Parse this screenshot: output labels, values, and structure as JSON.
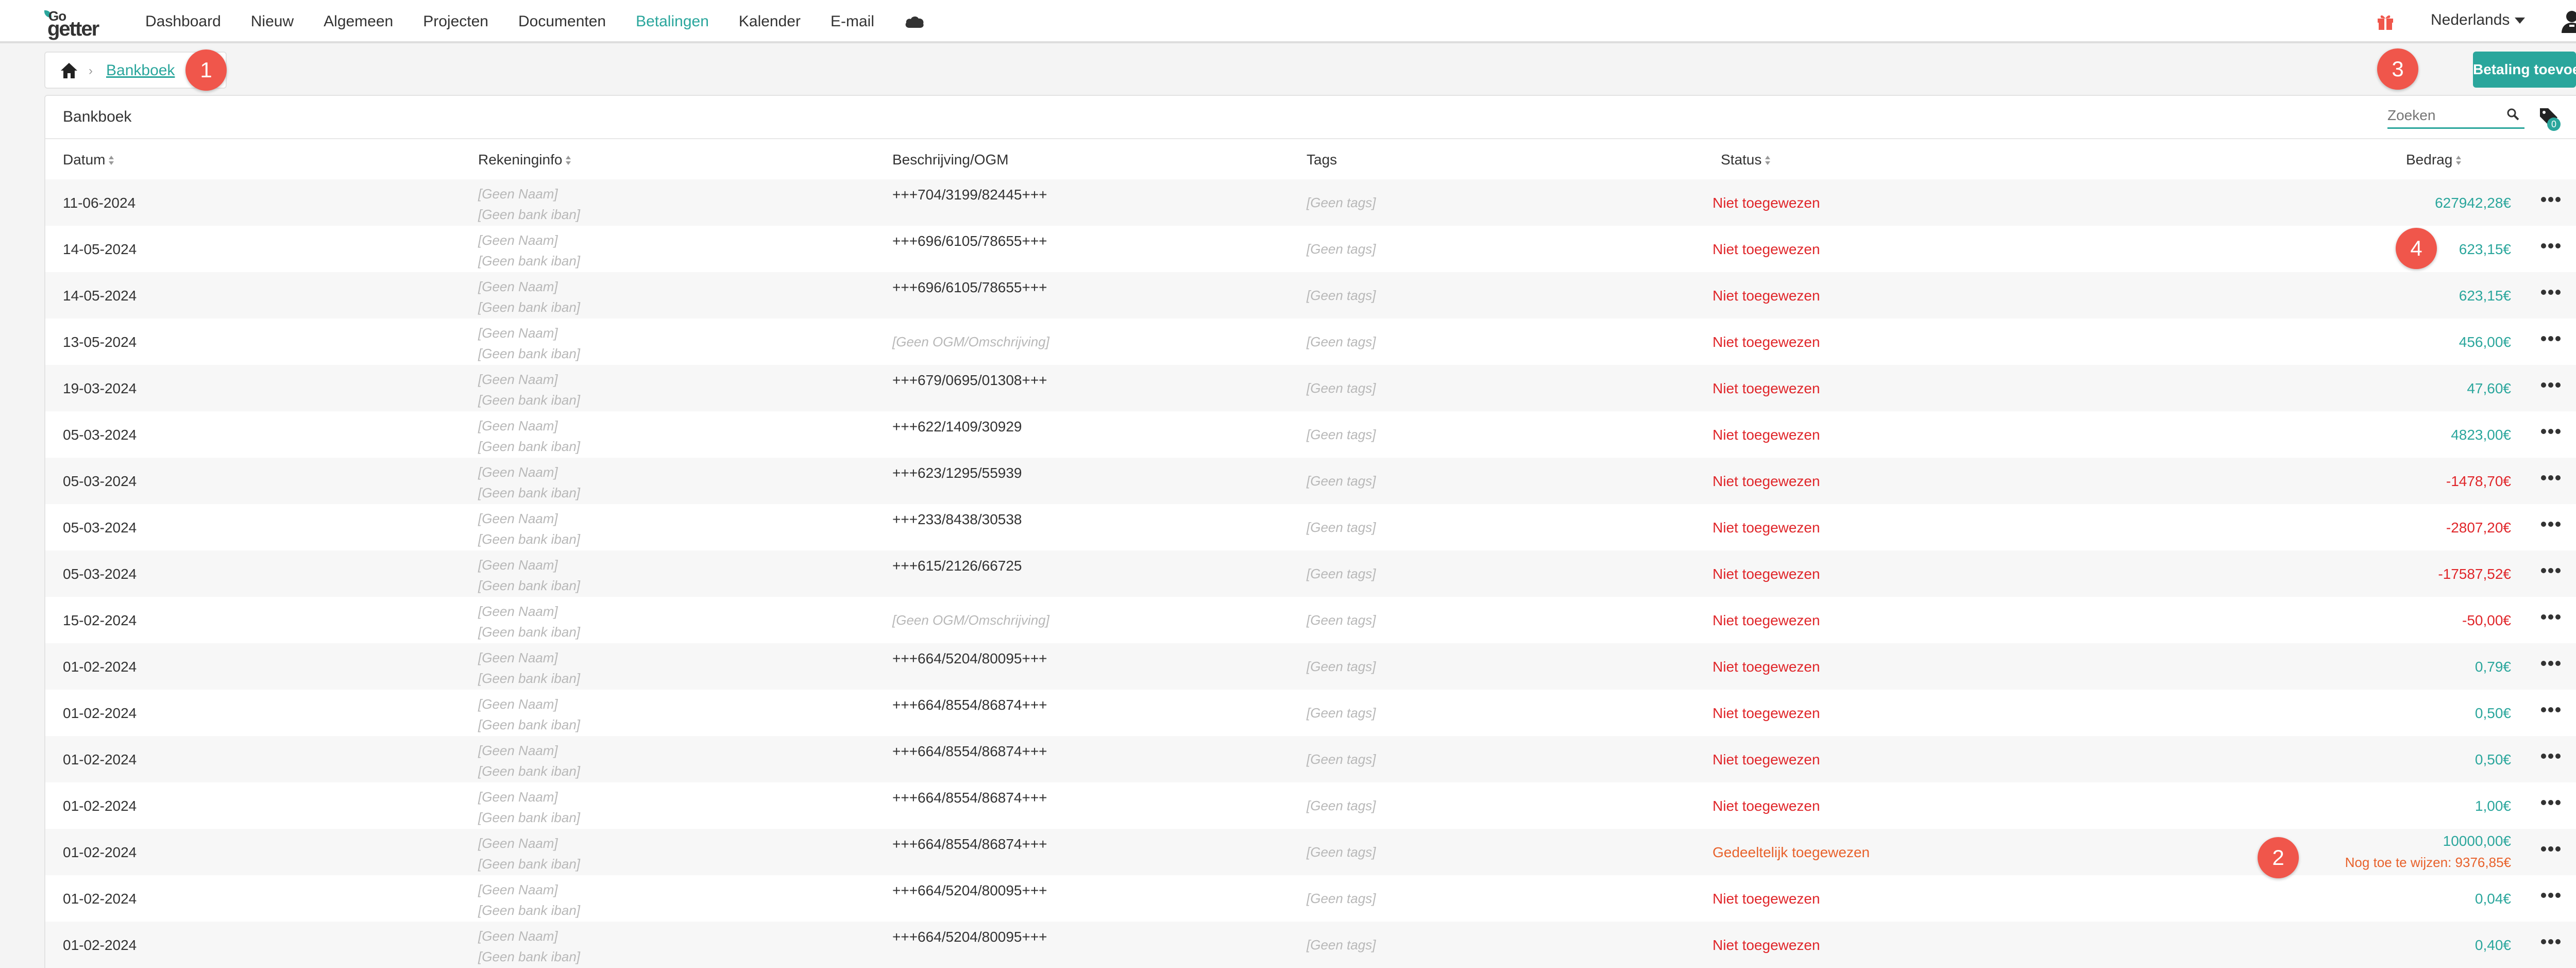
{
  "nav": {
    "logo_top": "Go",
    "logo_bottom": "getter",
    "items": [
      {
        "label": "Dashboard",
        "active": false
      },
      {
        "label": "Nieuw",
        "active": false
      },
      {
        "label": "Algemeen",
        "active": false
      },
      {
        "label": "Projecten",
        "active": false
      },
      {
        "label": "Documenten",
        "active": false
      },
      {
        "label": "Betalingen",
        "active": true
      },
      {
        "label": "Kalender",
        "active": false
      },
      {
        "label": "E-mail",
        "active": false
      }
    ],
    "language": "Nederlands"
  },
  "breadcrumb": {
    "current": "Bankboek"
  },
  "badges": [
    "1",
    "2",
    "3",
    "4"
  ],
  "actions": {
    "add_payment": "Betaling toevoegen"
  },
  "panel": {
    "title": "Bankboek",
    "search_placeholder": "Zoeken",
    "tag_count": "0"
  },
  "table": {
    "headers": {
      "date": "Datum",
      "account": "Rekeninginfo",
      "description": "Beschrijving/OGM",
      "tags": "Tags",
      "status": "Status",
      "amount": "Bedrag"
    },
    "rows": [
      {
        "date": "11-06-2024",
        "name": "[Geen Naam]",
        "iban": "[Geen bank iban]",
        "desc": "+++704/3199/82445+++",
        "tags": "[Geen tags]",
        "status": "Niet toegewezen",
        "amount": "627942,28€",
        "sign": "pos"
      },
      {
        "date": "14-05-2024",
        "name": "[Geen Naam]",
        "iban": "[Geen bank iban]",
        "desc": "+++696/6105/78655+++",
        "tags": "[Geen tags]",
        "status": "Niet toegewezen",
        "amount": "623,15€",
        "sign": "pos"
      },
      {
        "date": "14-05-2024",
        "name": "[Geen Naam]",
        "iban": "[Geen bank iban]",
        "desc": "+++696/6105/78655+++",
        "tags": "[Geen tags]",
        "status": "Niet toegewezen",
        "amount": "623,15€",
        "sign": "pos"
      },
      {
        "date": "13-05-2024",
        "name": "[Geen Naam]",
        "iban": "[Geen bank iban]",
        "desc": "[Geen OGM/Omschrijving]",
        "tags": "[Geen tags]",
        "status": "Niet toegewezen",
        "amount": "456,00€",
        "sign": "pos"
      },
      {
        "date": "19-03-2024",
        "name": "[Geen Naam]",
        "iban": "[Geen bank iban]",
        "desc": "+++679/0695/01308+++",
        "tags": "[Geen tags]",
        "status": "Niet toegewezen",
        "amount": "47,60€",
        "sign": "pos"
      },
      {
        "date": "05-03-2024",
        "name": "[Geen Naam]",
        "iban": "[Geen bank iban]",
        "desc": "+++622/1409/30929",
        "tags": "[Geen tags]",
        "status": "Niet toegewezen",
        "amount": "4823,00€",
        "sign": "pos"
      },
      {
        "date": "05-03-2024",
        "name": "[Geen Naam]",
        "iban": "[Geen bank iban]",
        "desc": "+++623/1295/55939",
        "tags": "[Geen tags]",
        "status": "Niet toegewezen",
        "amount": "-1478,70€",
        "sign": "neg"
      },
      {
        "date": "05-03-2024",
        "name": "[Geen Naam]",
        "iban": "[Geen bank iban]",
        "desc": "+++233/8438/30538",
        "tags": "[Geen tags]",
        "status": "Niet toegewezen",
        "amount": "-2807,20€",
        "sign": "neg"
      },
      {
        "date": "05-03-2024",
        "name": "[Geen Naam]",
        "iban": "[Geen bank iban]",
        "desc": "+++615/2126/66725",
        "tags": "[Geen tags]",
        "status": "Niet toegewezen",
        "amount": "-17587,52€",
        "sign": "neg"
      },
      {
        "date": "15-02-2024",
        "name": "[Geen Naam]",
        "iban": "[Geen bank iban]",
        "desc": "[Geen OGM/Omschrijving]",
        "tags": "[Geen tags]",
        "status": "Niet toegewezen",
        "amount": "-50,00€",
        "sign": "neg"
      },
      {
        "date": "01-02-2024",
        "name": "[Geen Naam]",
        "iban": "[Geen bank iban]",
        "desc": "+++664/5204/80095+++",
        "tags": "[Geen tags]",
        "status": "Niet toegewezen",
        "amount": "0,79€",
        "sign": "pos"
      },
      {
        "date": "01-02-2024",
        "name": "[Geen Naam]",
        "iban": "[Geen bank iban]",
        "desc": "+++664/8554/86874+++",
        "tags": "[Geen tags]",
        "status": "Niet toegewezen",
        "amount": "0,50€",
        "sign": "pos"
      },
      {
        "date": "01-02-2024",
        "name": "[Geen Naam]",
        "iban": "[Geen bank iban]",
        "desc": "+++664/8554/86874+++",
        "tags": "[Geen tags]",
        "status": "Niet toegewezen",
        "amount": "0,50€",
        "sign": "pos"
      },
      {
        "date": "01-02-2024",
        "name": "[Geen Naam]",
        "iban": "[Geen bank iban]",
        "desc": "+++664/8554/86874+++",
        "tags": "[Geen tags]",
        "status": "Niet toegewezen",
        "amount": "1,00€",
        "sign": "pos"
      },
      {
        "date": "01-02-2024",
        "name": "[Geen Naam]",
        "iban": "[Geen bank iban]",
        "desc": "+++664/8554/86874+++",
        "tags": "[Geen tags]",
        "status": "Gedeeltelijk toegewezen",
        "amount": "10000,00€",
        "sign": "pos",
        "sub": "Nog toe te wijzen: 9376,85€"
      },
      {
        "date": "01-02-2024",
        "name": "[Geen Naam]",
        "iban": "[Geen bank iban]",
        "desc": "+++664/5204/80095+++",
        "tags": "[Geen tags]",
        "status": "Niet toegewezen",
        "amount": "0,04€",
        "sign": "pos"
      },
      {
        "date": "01-02-2024",
        "name": "[Geen Naam]",
        "iban": "[Geen bank iban]",
        "desc": "+++664/5204/80095+++",
        "tags": "[Geen tags]",
        "status": "Niet toegewezen",
        "amount": "0,40€",
        "sign": "pos"
      }
    ]
  },
  "colors": {
    "accent": "#2aa69c",
    "negative": "#e0262a",
    "partial": "#e8622c",
    "badge": "#f0564b"
  }
}
